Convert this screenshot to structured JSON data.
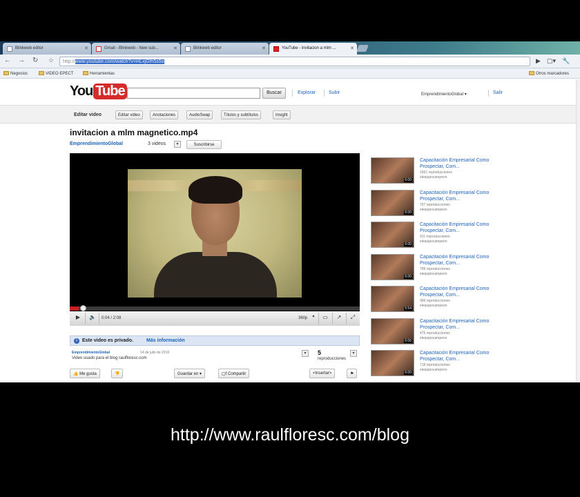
{
  "browser": {
    "tabs": [
      {
        "label": "Blinkweb editor",
        "icon": "page-icon"
      },
      {
        "label": "Gmail - Blinkweb - New sub...",
        "icon": "gmail-icon"
      },
      {
        "label": "Blinkweb editor",
        "icon": "page-icon"
      },
      {
        "label": "YouTube - invitacion a mlm ...",
        "icon": "youtube-icon",
        "active": true
      }
    ],
    "url_prefix": "http://",
    "url_selected": "www.youtube.com/watch?v=HLxjGfh5s5o",
    "bookmarks": [
      "Negocios",
      "VIDEO EPECT",
      "Herramientas"
    ],
    "other_bookmarks": "Otros marcadores"
  },
  "youtube": {
    "logo_you": "You",
    "logo_tube": "Tube",
    "search_button": "Buscar",
    "nav_explore": "Explorar",
    "nav_upload": "Subir",
    "username": "EmprendimientoGlobal ▾",
    "signout": "Salir",
    "edit_label": "Editar video",
    "edit_buttons": [
      "Editar video",
      "Anotaciones",
      "AudioSwap",
      "Títulos y subtítulos",
      "Insight"
    ],
    "video_title": "invitacion a mlm magnetico.mp4",
    "channel": "EmprendimientoGlobal",
    "video_count": "3 videos",
    "subscribe": "Suscribirse",
    "player": {
      "time": "0:04 / 2:08",
      "quality": "360p",
      "progress": 0.03
    },
    "private_notice": "Este video es privado.",
    "private_link": "Más información",
    "uploader": "EmprendimientoGlobal",
    "upload_date": "14 de julio de 2010",
    "description": "Video usado para el blog raulfloresc.com",
    "views": "5",
    "views_label": "reproducciones",
    "like": "Me gusta",
    "save_to": "Guardar en",
    "share": "Compartir",
    "embed": "<Insertar>",
    "related": [
      {
        "title": "Capacitación Empresarial Como Prospectar, Com...",
        "views": "1661 reproducciones",
        "author": "elequipocampeon",
        "duration": "6:00"
      },
      {
        "title": "Capacitación Empresarial Como Prospectar, Com...",
        "views": "707 reproducciones",
        "author": "elequipocampeon",
        "duration": "6:00"
      },
      {
        "title": "Capacitación Empresarial Como Prospectar, Com...",
        "views": "911 reproducciones",
        "author": "elequipocampeon",
        "duration": "6:00"
      },
      {
        "title": "Capacitación Empresarial Como Prospectar, Com...",
        "views": "799 reproducciones",
        "author": "elequipocampeon",
        "duration": "6:00"
      },
      {
        "title": "Capacitación Empresarial Como Prospectar, Com...",
        "views": "966 reproducciones",
        "author": "elequipocampeon",
        "duration": "5:54"
      },
      {
        "title": "Capacitación Empresarial Como Prospectar, Com...",
        "views": "475 reproducciones",
        "author": "elequipocampeon",
        "duration": "6:06"
      },
      {
        "title": "Capacitación Empresarial Como Prospectar, Com...",
        "views": "718 reproducciones",
        "author": "elequipocampeon",
        "duration": "6:00"
      }
    ]
  },
  "caption": "http://www.raulfloresc.com/blog",
  "colors": {
    "link": "#1c62b9",
    "youtube_red": "#d62b2b",
    "private_bar": "#dbe5f3"
  }
}
